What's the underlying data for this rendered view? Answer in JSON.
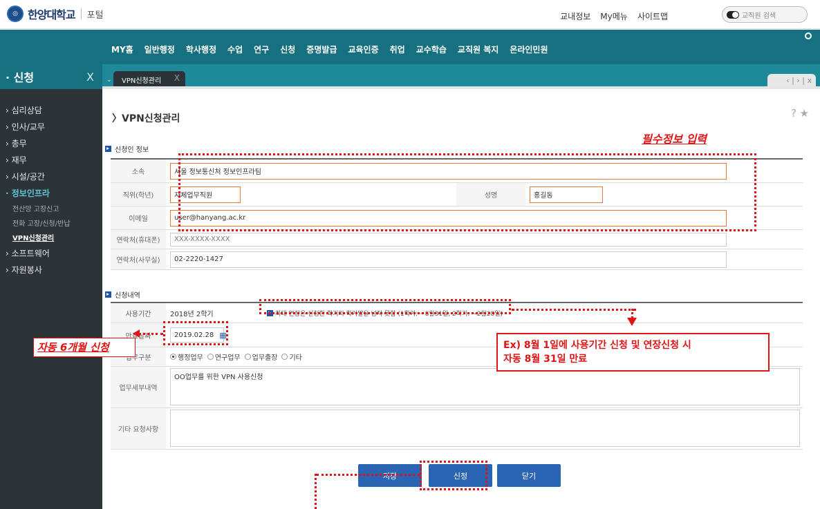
{
  "header": {
    "logo_text": "한양대학교",
    "portal_label": "포털",
    "links": [
      "교내정보",
      "My메뉴",
      "사이트맵"
    ],
    "search_placeholder": "교직원 검색"
  },
  "mainnav": {
    "items": [
      "MY홈",
      "일반행정",
      "학사행정",
      "수업",
      "연구",
      "신청",
      "증명발급",
      "교육인증",
      "취업",
      "교수학습",
      "교직원 복지",
      "온라인민원"
    ]
  },
  "sidebar": {
    "title": "신청",
    "close": "X",
    "items": [
      {
        "label": "심리상담"
      },
      {
        "label": "인사/교무"
      },
      {
        "label": "총무"
      },
      {
        "label": "재무"
      },
      {
        "label": "시설/공간"
      },
      {
        "label": "정보인프라"
      },
      {
        "label": "전산망 고장신고"
      },
      {
        "label": "전화 고장/신청/반납"
      },
      {
        "label": "VPN신청관리"
      },
      {
        "label": "소프트웨어"
      },
      {
        "label": "자원봉사"
      }
    ]
  },
  "tabs": {
    "active_label": "VPN신청관리",
    "close": "X",
    "nav": "‹ | › | x"
  },
  "page": {
    "title": "〉VPN신청관리",
    "help": "? ★"
  },
  "applicant": {
    "section_title": "신청인 정보",
    "affiliation_label": "소속",
    "affiliation_value": "서울 정보통신처 정보인프라팀",
    "position_label": "직위(학년)",
    "position_value": "자체업무직원",
    "name_label": "성명",
    "name_value": "홍길동",
    "email_label": "이메일",
    "email_value": "user@hanyang.ac.kr",
    "mobile_label": "연락처(휴대폰)",
    "mobile_value": "XXX-XXXX-XXXX",
    "office_label": "연락처(사무실)",
    "office_value": "02-2220-1427"
  },
  "request": {
    "section_title": "신청내역",
    "period_label": "사용기간",
    "period_value": "2018년 2학기",
    "period_note": "최대 연장은 신청한 학기의 학기말을 넘지 못함 (1학기: ~8월31일, 2학기: ~2월28일)",
    "expiry_label": "만료날짜",
    "expiry_value": "2019.02.28",
    "type_label": "업무구분",
    "type_options": [
      "행정업무",
      "연구업무",
      "업무출장",
      "기타"
    ],
    "details_label": "업무세부내역",
    "details_value": "OO업무를 위한 VPN 사용신청",
    "other_label": "기타 요청사항",
    "other_value": ""
  },
  "buttons": {
    "save": "저장",
    "apply": "신청",
    "close": "닫기"
  },
  "annotations": {
    "required_info": "필수정보 입력",
    "auto_six_months": "자동 6개월 신청",
    "example_callout_line1": "Ex) 8월 1일에 사용기간 신청 및 연장신청 시",
    "example_callout_line2": "자동 8월 31일 만료",
    "accent_color": "#e01414"
  }
}
